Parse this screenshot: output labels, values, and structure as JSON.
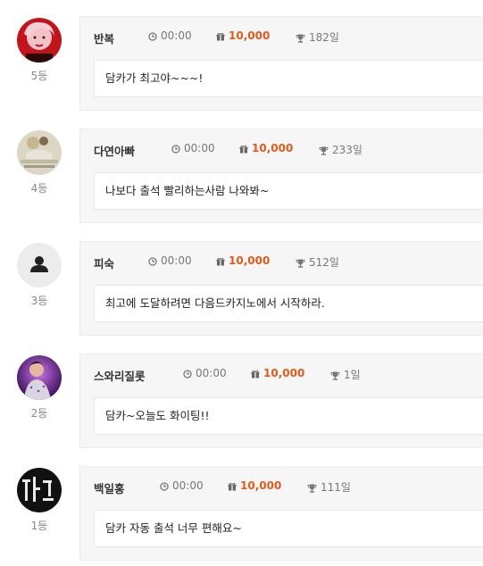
{
  "entries": [
    {
      "name": "반복",
      "time": "00:00",
      "points": "10,000",
      "days": "182일",
      "rank": "5등",
      "message": "담카가 최고야~~~!",
      "avatar": "photo-red"
    },
    {
      "name": "다연아빠",
      "time": "00:00",
      "points": "10,000",
      "days": "233일",
      "rank": "4등",
      "message": "나보다 출석 빨리하는사람 나와봐~",
      "avatar": "photo-cat"
    },
    {
      "name": "피숙",
      "time": "00:00",
      "points": "10,000",
      "days": "512일",
      "rank": "3등",
      "message": "최고에 도달하려면 다음드카지노에서 시작하라.",
      "avatar": "default-user-icon"
    },
    {
      "name": "스와리질롯",
      "time": "00:00",
      "points": "10,000",
      "days": "1일",
      "rank": "2등",
      "message": "담카~오늘도 화이팅!!",
      "avatar": "photo-purple"
    },
    {
      "name": "백일홍",
      "time": "00:00",
      "points": "10,000",
      "days": "111일",
      "rank": "1등",
      "message": "담카 자동 출석 너무 편해요~",
      "avatar": "photo-dark-sign"
    }
  ],
  "colors": {
    "points": "#e05a1a",
    "card_bg": "#f6f6f6",
    "border": "#ececec"
  }
}
